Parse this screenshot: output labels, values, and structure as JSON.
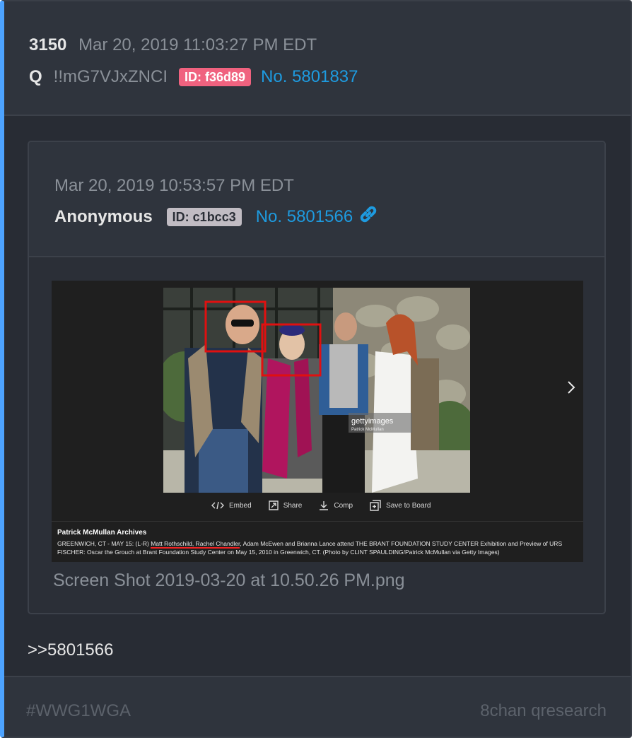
{
  "post": {
    "number": "3150",
    "date": "Mar 20, 2019 11:03:27 PM EDT",
    "author": "Q",
    "tripcode": "!!mG7VJxZNCI",
    "id_label": "ID: f36d89",
    "id_color": "#f0627f",
    "post_no": "No. 5801837"
  },
  "quoted": {
    "date": "Mar 20, 2019 10:53:57 PM EDT",
    "author": "Anonymous",
    "id_label": "ID: c1bcc3",
    "id_color": "#c1bcc3",
    "post_no": "No. 5801566",
    "attachment": {
      "filename": "Screen Shot 2019-03-20 at 10.50.26 PM.png",
      "watermark": "gettyimages",
      "watermark_credit": "Patrick McMullan",
      "actions": [
        "Embed",
        "Share",
        "Comp",
        "Save to Board"
      ],
      "caption_title": "Patrick McMullan Archives",
      "caption_prefix": "GREENWICH, CT - MAY 15: (L-R) ",
      "caption_names": "Matt Rothschild, Rachel Chandler",
      "caption_rest": ", Adam McEwen and Brianna Lance attend THE BRANT FOUNDATION STUDY CENTER Exhibition and Preview of URS FISCHER: Oscar the Grouch at Brant Foundation Study Center on May 15, 2010 in Greenwich, CT. (Photo by CLINT SPAULDING/Patrick McMullan via Getty Images)"
    }
  },
  "reply_text": ">>5801566",
  "footer": {
    "hashtag": "#WWG1WGA",
    "source": "8chan qresearch"
  },
  "colors": {
    "accent_link": "#1e9be0",
    "left_bar": "#4da3ff"
  },
  "icons": [
    "link-icon",
    "chevron-right-icon",
    "embed-icon",
    "share-icon",
    "download-icon",
    "save-board-icon"
  ]
}
